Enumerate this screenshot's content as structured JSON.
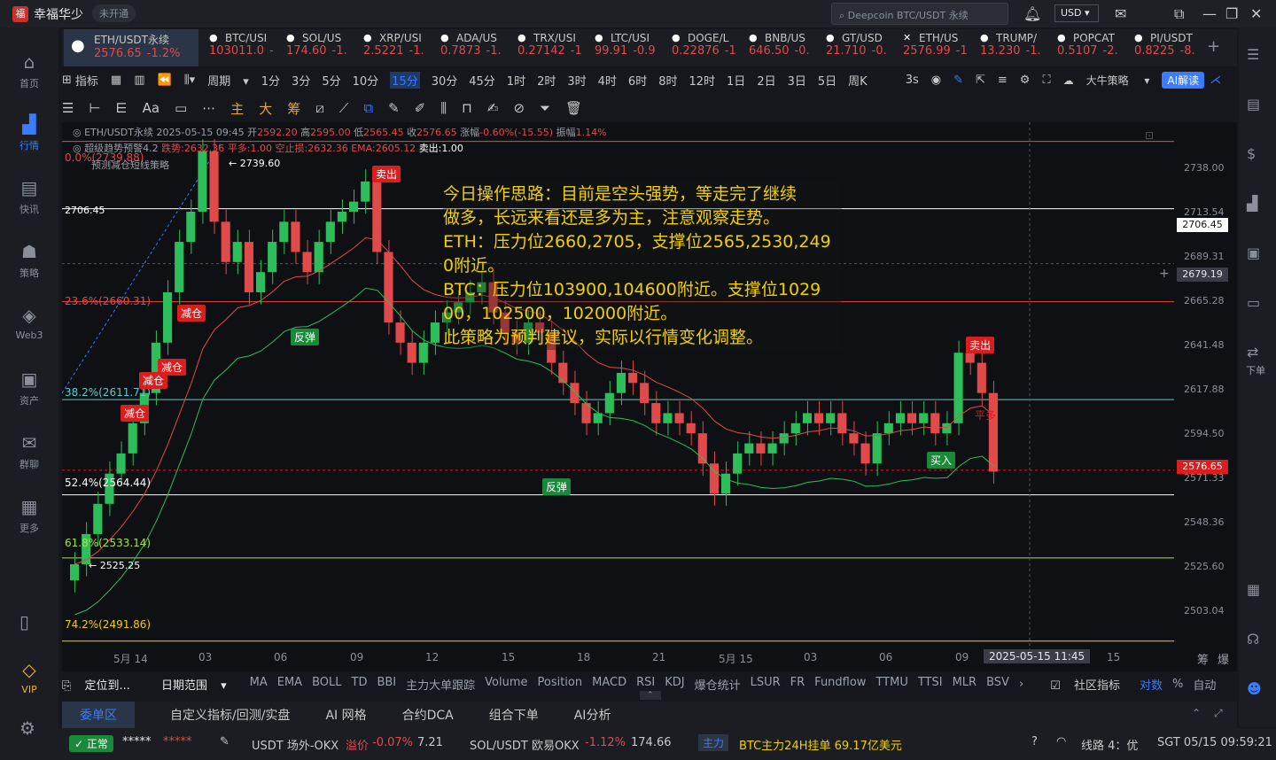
{
  "app": {
    "name": "幸福华少",
    "status_badge": "未开通"
  },
  "search": {
    "placeholder": "Deepcoin BTC/USDT 永续"
  },
  "currency": "USD",
  "sidebar": {
    "items": [
      {
        "label": "首页",
        "icon": "home-icon"
      },
      {
        "label": "行情",
        "icon": "chart-icon"
      },
      {
        "label": "快讯",
        "icon": "news-icon"
      },
      {
        "label": "策略",
        "icon": "robot-icon"
      },
      {
        "label": "Web3",
        "icon": "web3-icon"
      },
      {
        "label": "资产",
        "icon": "wallet-icon"
      },
      {
        "label": "群聊",
        "icon": "chat-icon"
      },
      {
        "label": "更多",
        "icon": "grid-icon"
      },
      {
        "label": "VIP",
        "icon": "diamond-icon"
      }
    ]
  },
  "rightbar": {
    "order_label": "下单"
  },
  "tabs": [
    {
      "name": "ETH/USDT永续",
      "price": "2576.65",
      "change": "-1.2%"
    },
    {
      "name": "BTC/USI",
      "price": "103011.0",
      "change": "-"
    },
    {
      "name": "SOL/US",
      "price": "174.60",
      "change": "-1."
    },
    {
      "name": "XRP/USI",
      "price": "2.5221",
      "change": "-1."
    },
    {
      "name": "ADA/US",
      "price": "0.7873",
      "change": "-1."
    },
    {
      "name": "TRX/USI",
      "price": "0.27142",
      "change": "-1"
    },
    {
      "name": "LTC/USI",
      "price": "99.91",
      "change": "-0.9"
    },
    {
      "name": "DOGE/L",
      "price": "0.22876",
      "change": "-1"
    },
    {
      "name": "BNB/US",
      "price": "646.50",
      "change": "-0."
    },
    {
      "name": "GT/USD",
      "price": "21.710",
      "change": "-0."
    },
    {
      "name": "ETH/US",
      "price": "2576.99",
      "change": "-1"
    },
    {
      "name": "TRUMP/",
      "price": "13.230",
      "change": "-1."
    },
    {
      "name": "POPCAT",
      "price": "0.5107",
      "change": "-2."
    },
    {
      "name": "PI/USDT",
      "price": "0.8225",
      "change": "-8."
    }
  ],
  "toolbar": {
    "indicator": "指标",
    "period": "周期",
    "intervals": [
      "1分",
      "3分",
      "5分",
      "10分",
      "15分",
      "30分",
      "45分",
      "1时",
      "2时",
      "3时",
      "4时",
      "6时",
      "8时",
      "12时",
      "1日",
      "2日",
      "3日",
      "5日",
      "周K"
    ],
    "selected_interval": "15分",
    "seconds": "3s",
    "strategy": "大牛策略",
    "ai_btn": "AI解读"
  },
  "drawtools": {
    "main": "主",
    "big": "大",
    "chips": "筹"
  },
  "info": {
    "line1": {
      "symbol": "ETH/USDT永续",
      "datetime": "2025-05-15 09:45",
      "open_l": "开",
      "open": "2592.20",
      "high_l": "高",
      "high": "2595.00",
      "low_l": "低",
      "low": "2565.45",
      "close_l": "收",
      "close": "2576.65",
      "chg_l": "涨幅",
      "chg": "-0.60%(-15.55)",
      "amp_l": "振幅",
      "amp": "1.14%"
    },
    "line2": {
      "name": "超级趋势预警4.2",
      "short": "跌势:2632.36",
      "flat": "平多:1.00",
      "stop": "空止损:2632.36",
      "ema": "EMA:2605.12",
      "sell": "卖出:1.00"
    }
  },
  "annotation": {
    "l1": "今日操作思路：目前是空头强势，等走完了继续",
    "l2": "做多，长远来看还是多为主，注意观察走势。",
    "l3": "ETH：压力位2660,2705，支撑位2565,2530,249",
    "l4": "0附近。",
    "l5": "BTC：压力位103900,104600附近。支撑位1029",
    "l6": "00，102500，102000附近。",
    "l7": "此策略为预判建议，实际以行情变化调整。"
  },
  "fib": {
    "f0": "0.0%(2739.88)",
    "f0_sub": "预测减仓短线策略",
    "f236": "23.6%(2660.31)",
    "f382": "38.2%(2611.71)",
    "f5": "52.4%(2564.44)",
    "f618": "61.8%(2533.14)",
    "f742": "74.2%(2491.86)"
  },
  "chart_marks": {
    "high": "2739.60",
    "low": "2525.25",
    "hline": "2706.45"
  },
  "yaxis": [
    "2738.00",
    "2713.54",
    "2689.31",
    "2665.28",
    "2641.48",
    "2617.88",
    "2594.50",
    "2571.33",
    "2548.36",
    "2525.60",
    "2503.04"
  ],
  "price_tags": {
    "white": "2706.45",
    "cross": "2679.19",
    "last": "2576.65"
  },
  "xaxis": [
    "5月 14",
    "03",
    "06",
    "09",
    "12",
    "15",
    "18",
    "21",
    "5月 15",
    "03",
    "06",
    "09",
    "15"
  ],
  "x_cursor": "2025-05-15 11:45",
  "axis_right": {
    "a": "筹",
    "b": "爆"
  },
  "signals": {
    "sell": "卖出",
    "buy": "买入",
    "reduce": "减仓",
    "rebound": "反弹",
    "long": "平多"
  },
  "chart_data": {
    "type": "candlestick",
    "title": "ETH/USDT永续 15分",
    "ylim": [
      2490,
      2745
    ],
    "close_series": [
      2530,
      2545,
      2560,
      2575,
      2585,
      2600,
      2615,
      2640,
      2665,
      2690,
      2705,
      2735,
      2700,
      2680,
      2690,
      2665,
      2675,
      2690,
      2700,
      2685,
      2675,
      2690,
      2700,
      2705,
      2710,
      2720,
      2685,
      2650,
      2640,
      2630,
      2640,
      2650,
      2655,
      2660,
      2665,
      2670,
      2655,
      2645,
      2640,
      2650,
      2645,
      2630,
      2620,
      2610,
      2600,
      2605,
      2615,
      2625,
      2620,
      2610,
      2600,
      2605,
      2600,
      2595,
      2580,
      2565,
      2575,
      2585,
      2590,
      2585,
      2590,
      2595,
      2600,
      2605,
      2600,
      2605,
      2595,
      2590,
      2580,
      2595,
      2600,
      2605,
      2600,
      2605,
      2595,
      2600,
      2635,
      2630,
      2615,
      2576
    ]
  },
  "indicators": {
    "locate": "定位到...",
    "range": "日期范围",
    "list": [
      "MA",
      "EMA",
      "BOLL",
      "TD",
      "BBI",
      "主力大单跟踪",
      "Volume",
      "Position",
      "MACD",
      "RSI",
      "KDJ",
      "爆仓统计",
      "LSUR",
      "FR",
      "Fundflow",
      "TTMU",
      "TTSI",
      "MLR",
      "BSV"
    ],
    "community": "社区指标",
    "log": "对数",
    "pct": "%",
    "auto": "自动"
  },
  "panel_tabs": [
    "委单区",
    "自定义指标/回测/实盘",
    "AI 网格",
    "合约DCA",
    "组合下单",
    "AI分析"
  ],
  "status": {
    "normal": "正常",
    "masked": "*****",
    "t1_name": "USDT 场外-OKX",
    "t1_tag": "溢价",
    "t1_chg": "-0.07%",
    "t1_val": "7.21",
    "t2_name": "SOL/USDT 欧易OKX",
    "t2_chg": "-1.12%",
    "t2_val": "174.66",
    "main_tag": "主力",
    "main_txt": "BTC主力24H挂单 69.17亿美元",
    "line": "线路 4：优",
    "time": "SGT 05/15 09:59:21"
  }
}
